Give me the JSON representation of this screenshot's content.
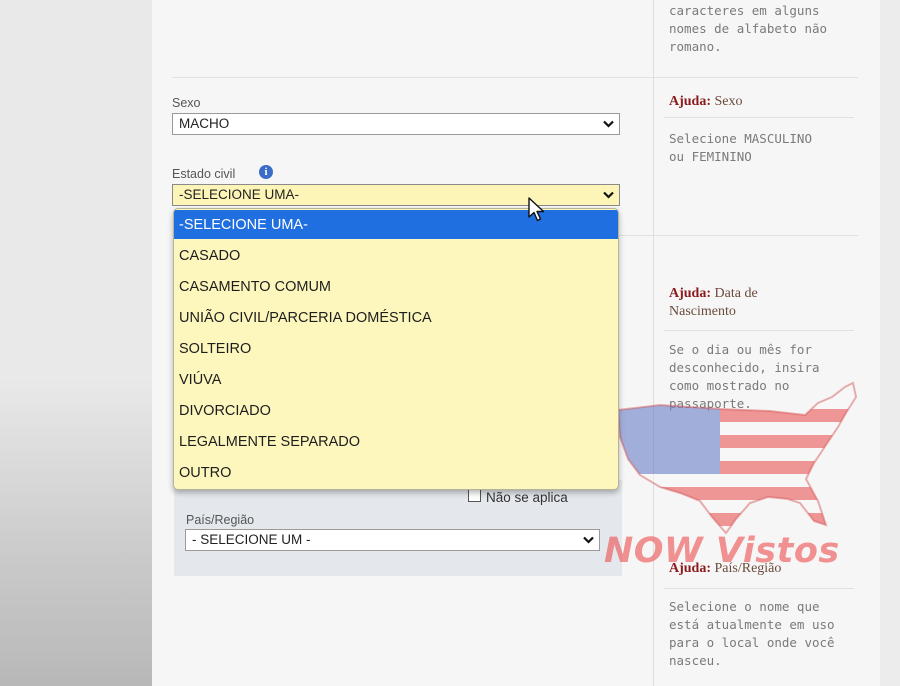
{
  "top_help": {
    "lines": [
      "caracteres em alguns",
      "nomes de alfabeto não",
      "romano."
    ]
  },
  "sexo": {
    "label": "Sexo",
    "value": "MACHO",
    "help_prefix": "Ajuda:",
    "help_title": "Sexo",
    "help_lines": [
      "Selecione MASCULINO",
      "ou FEMININO"
    ]
  },
  "estado_civil": {
    "label": "Estado civil",
    "value": "-SELECIONE UMA-",
    "options": [
      "-SELECIONE UMA-",
      "CASADO",
      "CASAMENTO COMUM",
      "UNIÃO CIVIL/PARCERIA DOMÉSTICA",
      "SOLTEIRO",
      "VIÚVA",
      "DIVORCIADO",
      "LEGALMENTE SEPARADO",
      "OUTRO"
    ],
    "selected_index": 0
  },
  "data_nascimento_help": {
    "prefix": "Ajuda:",
    "title_line1": "Data de",
    "title_line2": "Nascimento",
    "lines": [
      "Se o dia ou mês for",
      "desconhecido, insira",
      "como mostrado no",
      "passaporte."
    ]
  },
  "nascimento_local": {
    "na_label": "Não se aplica",
    "pais_label": "País/Região",
    "pais_value": "- SELECIONE UM -"
  },
  "pais_help": {
    "prefix": "Ajuda:",
    "title": "País/Região",
    "lines": [
      "Selecione o nome que",
      "está atualmente em uso",
      "para o local onde você",
      "nasceu."
    ]
  },
  "watermark": {
    "text": "NOW Vistos"
  },
  "colors": {
    "highlight": "#1f6fe0",
    "dropdown_bg": "#fdf7bd",
    "help_title": "#8b1a1a"
  }
}
